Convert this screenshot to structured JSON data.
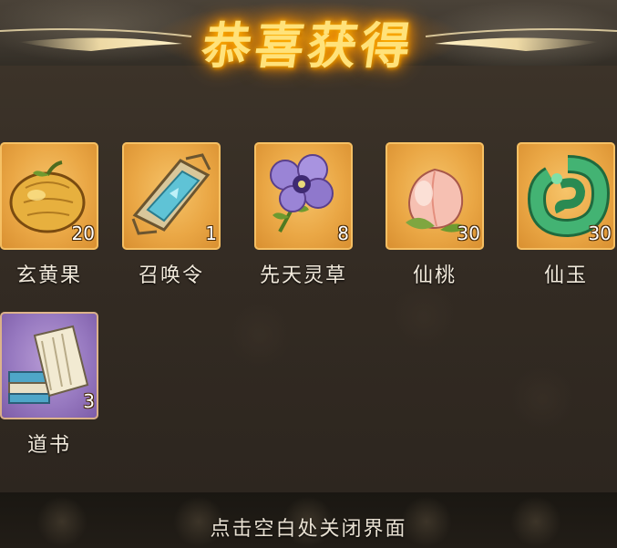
{
  "title": "恭喜获得",
  "items": [
    {
      "name": "玄黄果",
      "qty": "20",
      "rarity": "gold",
      "icon": "golden-fruit-icon"
    },
    {
      "name": "召唤令",
      "qty": "1",
      "rarity": "gold",
      "icon": "summon-token-icon"
    },
    {
      "name": "先天灵草",
      "qty": "8",
      "rarity": "gold",
      "icon": "spirit-herb-icon"
    },
    {
      "name": "仙桃",
      "qty": "30",
      "rarity": "gold",
      "icon": "immortal-peach-icon"
    },
    {
      "name": "仙玉",
      "qty": "30",
      "rarity": "gold",
      "icon": "jade-icon"
    },
    {
      "name": "道书",
      "qty": "3",
      "rarity": "purple",
      "icon": "taoist-book-icon"
    }
  ],
  "footer_hint": "点击空白处关闭界面",
  "colors": {
    "gold_card": "#eaa745",
    "purple_card": "#9779c0",
    "title_glow": "#ffb400"
  }
}
